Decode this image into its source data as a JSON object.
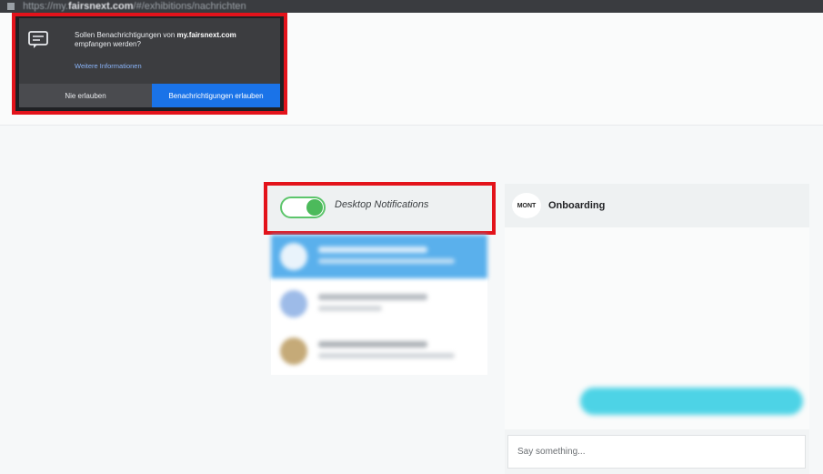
{
  "browser": {
    "url_prefix": "https://my.",
    "url_domain": "fairsnext.com",
    "url_path": "/#/exhibitions/nachrichten"
  },
  "permission_popup": {
    "message_prefix": "Sollen Benachrichtigungen von ",
    "message_domain": "my.fairsnext.com",
    "message_suffix": "empfangen werden?",
    "info_link": "Weitere Informationen",
    "deny_label": "Nie erlauben",
    "allow_label": "Benachrichtigungen erlauben",
    "icon": "chat-bubble-icon"
  },
  "notifications": {
    "label": "Desktop Notifications",
    "enabled": true
  },
  "chat_list": {
    "items": [
      {
        "active": true
      },
      {
        "active": false
      },
      {
        "active": false
      }
    ]
  },
  "chat_panel": {
    "title": "Onboarding",
    "logo_text": "MONT",
    "input_placeholder": "Say something..."
  },
  "colors": {
    "highlight": "#e3131b",
    "allow_button": "#1a73e8",
    "toggle_on": "#4cba5b",
    "active_chat": "#5ab0ec",
    "bubble": "#4dd3e6"
  }
}
